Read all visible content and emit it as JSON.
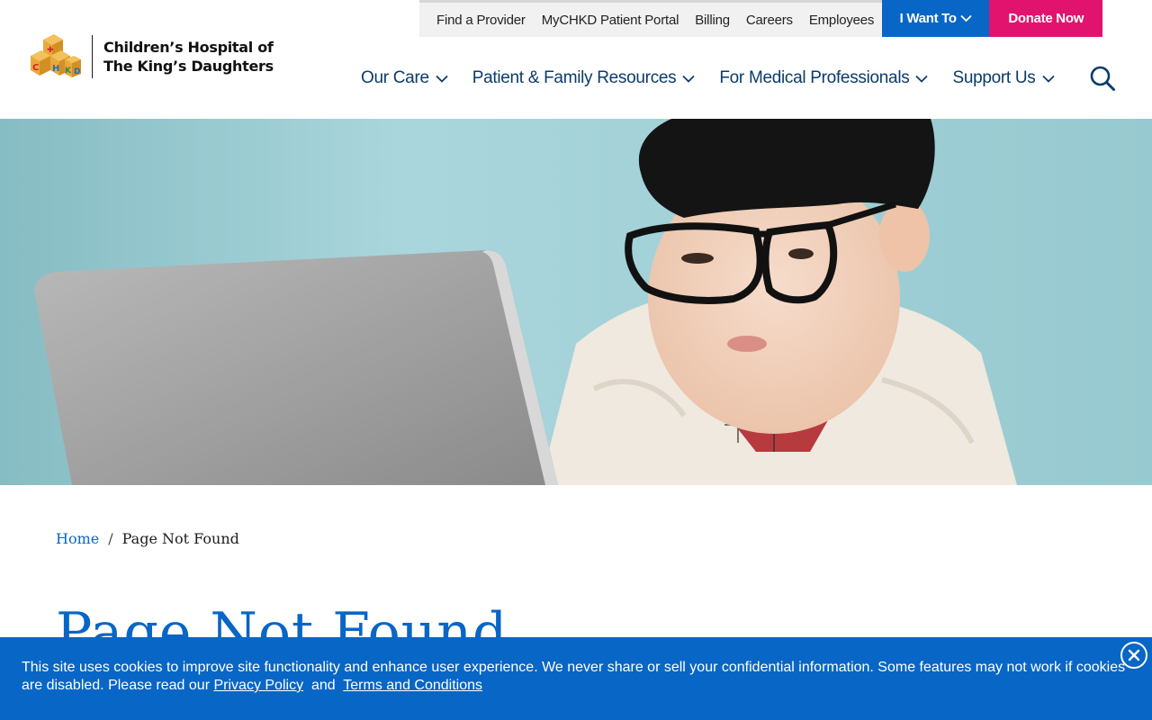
{
  "brand": {
    "name_line1": "Children’s Hospital of",
    "name_line2": "The King’s Daughters",
    "logo_letters": [
      "C",
      "H",
      "K",
      "D"
    ]
  },
  "utility_nav": {
    "links": [
      "Find a Provider",
      "MyCHKD Patient Portal",
      "Billing",
      "Careers",
      "Employees"
    ],
    "i_want_to": "I Want To",
    "donate": "Donate Now"
  },
  "main_nav": {
    "items": [
      "Our Care",
      "Patient & Family Resources",
      "For Medical Professionals",
      "Support Us"
    ]
  },
  "breadcrumb": {
    "home": "Home",
    "separator": "/",
    "current": "Page Not Found"
  },
  "page": {
    "title": "Page Not Found"
  },
  "cookie_banner": {
    "text": "This site uses cookies to improve site functionality and enhance user experience. We never share or sell your confidential information. Some features may not work if cookies are disabled. Please read our",
    "privacy_link": "Privacy Policy",
    "conjunction": "and",
    "terms_link": "Terms and Conditions"
  },
  "colors": {
    "primary_blue": "#0866c6",
    "navy": "#0b3b6b",
    "donate_pink": "#e2136e",
    "hero_background": "#a9d7dc"
  },
  "icons": {
    "search": "search-icon",
    "chevron": "chevron-down-icon",
    "close": "close-icon"
  }
}
